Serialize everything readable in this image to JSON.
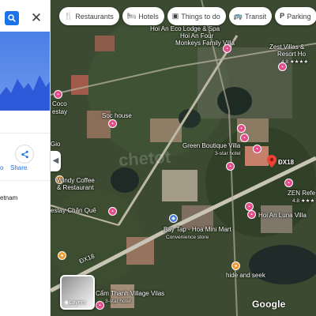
{
  "panel": {
    "share_label": "Share",
    "left_edge_text": "o",
    "gio_text": "Gio",
    "address_fragment": "etnam"
  },
  "chips": [
    {
      "label": "Restaurants",
      "icon": "fork-knife-icon",
      "glyph": "🍴"
    },
    {
      "label": "Hotels",
      "icon": "bed-icon",
      "glyph": "🛏"
    },
    {
      "label": "Things to do",
      "icon": "camera-icon",
      "glyph": "▣"
    },
    {
      "label": "Transit",
      "icon": "bus-icon",
      "glyph": "🚌"
    },
    {
      "label": "Parking",
      "icon": "parking-icon",
      "glyph": "P"
    },
    {
      "label": "P",
      "icon": "pharmacy-icon",
      "glyph": "✚"
    }
  ],
  "places": {
    "hoi_an_eco": "Hoi An Eco Lodge & Spa",
    "four_monkeys": "Hoi An Four",
    "four_monkeys_2": "Monkeys Family Villa",
    "zest_villas": "Zest Villas &",
    "zest_villas_2": "Resort Ho",
    "zest_stars": "4.8 ★★★★",
    "coco": "Coco",
    "coco_2": "estay",
    "soc_house": "Soc house",
    "green_boutique": "Green Boutique Villa",
    "green_boutique_sub": "3-star hotel",
    "dx18": "ĐX18",
    "windy": "Windy Coffee",
    "windy_2": "& Restaurant",
    "zen_ref": "ZEN Refe",
    "zen_ref_sub": "4.8 ★★★",
    "luna_villa": "Hoi An Luna Villa",
    "chan_que": "estay Chân Quê",
    "bay_tap": "Bay Tap - Hoa Mini Mart",
    "bay_tap_sub": "Convenience store",
    "road": "ĐX18",
    "hide_and_seek": "hide and seek",
    "cam_thanh": "Cẩm Thanh Village Vilas",
    "cam_thanh_sub": "3-star hotel",
    "google": "Google",
    "layers": "Layers",
    "watermark": "chetot"
  },
  "colors": {
    "accent": "#1a73e8",
    "hotel_pin": "#e24e8b",
    "shop_pin": "#4a7ce2",
    "food_pin": "#f29a38",
    "selected_pin": "#ea4335"
  }
}
